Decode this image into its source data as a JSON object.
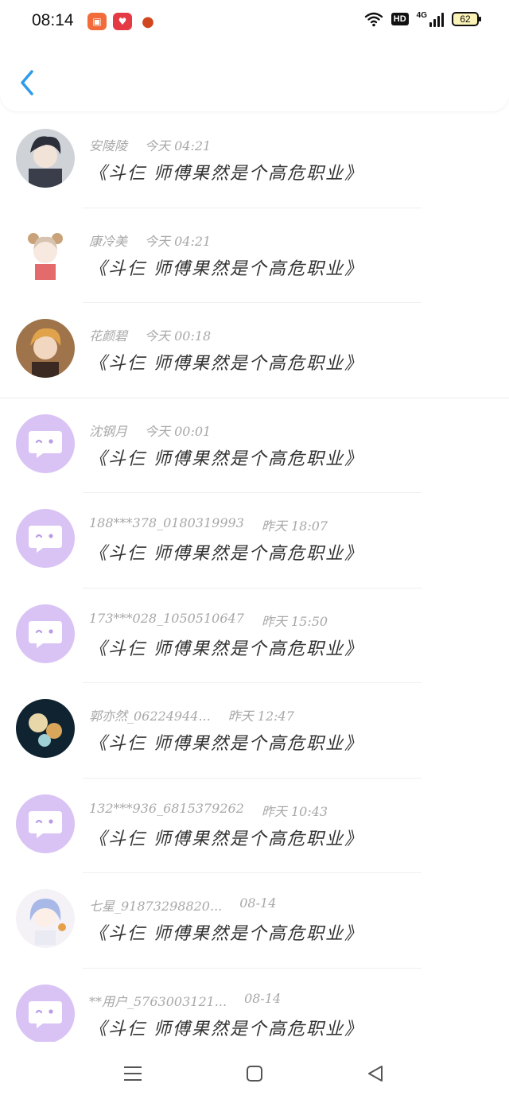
{
  "status_bar": {
    "time": "08:14",
    "battery": "62",
    "network_label": "4G",
    "hd_label": "HD"
  },
  "colors": {
    "accent": "#2f9bea",
    "default_avatar": "#d9c3f5",
    "meta_text": "#a8a8a8"
  },
  "header": {
    "back_icon": "chevron-left-icon"
  },
  "items": [
    {
      "name": "安陵陵",
      "time": "今天 04:21",
      "message": "《斗仨 师傅果然是个高危职业》",
      "avatar": "anime-boy-dark"
    },
    {
      "name": "康冷美",
      "time": "今天 04:21",
      "message": "《斗仨 师傅果然是个高危职业》",
      "avatar": "anime-girl-ears"
    },
    {
      "name": "花颜碧",
      "time": "今天 00:18",
      "message": "《斗仨 师傅果然是个高危职业》",
      "avatar": "anime-boy-orange"
    },
    {
      "name": "沈钢月",
      "time": "今天 00:01",
      "message": "《斗仨 师傅果然是个高危职业》",
      "avatar": "default"
    },
    {
      "name": "188***378_0180319993",
      "time": "昨天 18:07",
      "message": "《斗仨 师傅果然是个高危职业》",
      "avatar": "default"
    },
    {
      "name": "173***028_1050510647",
      "time": "昨天 15:50",
      "message": "《斗仨 师傅果然是个高危职业》",
      "avatar": "default"
    },
    {
      "name": "郭亦然_06224944...",
      "time": "昨天 12:47",
      "message": "《斗仨 师傅果然是个高危职业》",
      "avatar": "flowers-dark"
    },
    {
      "name": "132***936_6815379262",
      "time": "昨天 10:43",
      "message": "《斗仨 师傅果然是个高危职业》",
      "avatar": "default"
    },
    {
      "name": "七星_91873298820...",
      "time": "08-14",
      "message": "《斗仨 师傅果然是个高危职业》",
      "avatar": "anime-girl-blue"
    },
    {
      "name": "**用户_5763003121...",
      "time": "08-14",
      "message": "《斗仨 师傅果然是个高危职业》",
      "avatar": "default"
    }
  ],
  "nav": {
    "menu_icon": "menu-icon",
    "home_icon": "home-square-icon",
    "back_icon": "back-triangle-icon"
  }
}
